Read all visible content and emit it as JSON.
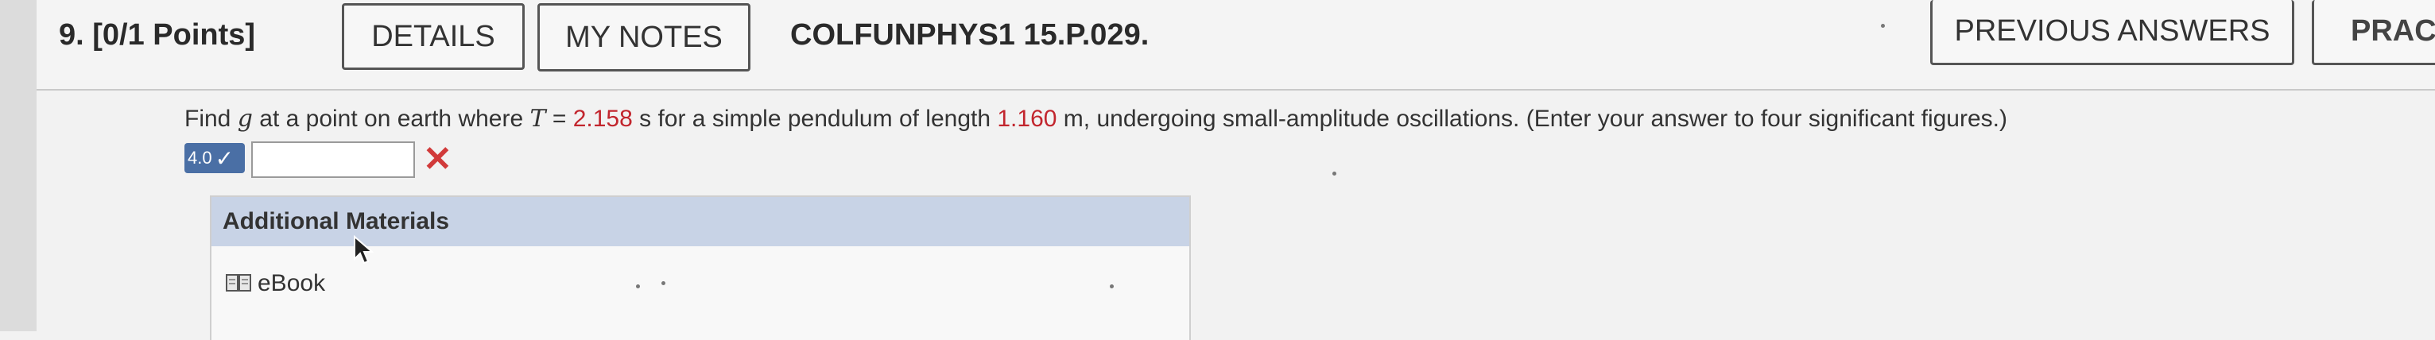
{
  "header": {
    "question_label": "9. [0/1 Points]",
    "details_label": "DETAILS",
    "my_notes_label": "MY NOTES",
    "problem_code": "COLFUNPHYS1 15.P.029.",
    "previous_answers_label": "PREVIOUS ANSWERS",
    "practice_label": "PRACT"
  },
  "question": {
    "part1": "Find ",
    "var_g": "g",
    "part2": " at a point on earth where ",
    "var_T": "T",
    "part3": " = ",
    "period_value": "2.158",
    "part4": " s for a simple pendulum of length ",
    "length_value": "1.160",
    "part5": " m, undergoing small-amplitude oscillations. (Enter your answer to four significant figures.)"
  },
  "answer": {
    "badge_text": "4.0",
    "value": "",
    "status": "incorrect"
  },
  "additional_materials": {
    "title": "Additional Materials",
    "ebook_label": "eBook"
  },
  "colors": {
    "value_highlight": "#c2262e",
    "badge_bg": "#4a6fa5",
    "materials_header_bg": "#c8d3e6",
    "wrong_mark": "#d13a3a"
  }
}
